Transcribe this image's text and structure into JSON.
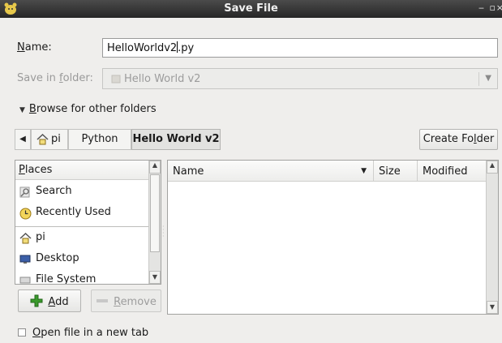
{
  "window": {
    "title": "Save File"
  },
  "form": {
    "name_label_u": "N",
    "name_label_rest": "ame:",
    "name_value": "HelloWorldv2",
    "name_value_tail": ".py",
    "folder_label_pre": "Save in ",
    "folder_label_u": "f",
    "folder_label_rest": "older:",
    "folder_value": "Hello World v2"
  },
  "browse": {
    "label_u": "B",
    "label_rest": "rowse for other folders"
  },
  "breadcrumb": {
    "items": [
      {
        "label": "pi",
        "icon": "home-icon"
      },
      {
        "label": "Python"
      },
      {
        "label": "Hello World v2",
        "active": true
      }
    ]
  },
  "toolbar": {
    "create_folder_pre": "Create Fo",
    "create_folder_u": "l",
    "create_folder_rest": "der"
  },
  "places": {
    "header_u": "P",
    "header_rest": "laces",
    "items": [
      {
        "label": "Search",
        "icon": "search-icon"
      },
      {
        "label": "Recently Used",
        "icon": "clock-icon"
      },
      {
        "label": "pi",
        "icon": "home-icon"
      },
      {
        "label": "Desktop",
        "icon": "desktop-icon"
      },
      {
        "label": "File System",
        "icon": "drive-icon"
      }
    ],
    "add_u": "A",
    "add_rest": "dd",
    "remove_u": "R",
    "remove_rest": "emove"
  },
  "files": {
    "columns": [
      {
        "label": "Name"
      },
      {
        "label": "Size"
      },
      {
        "label": "Modified"
      }
    ]
  },
  "options": {
    "new_tab_u": "O",
    "new_tab_rest": "pen file in a new tab",
    "new_tab_checked": false
  },
  "colors": {
    "titlebar": "#2f2f2f",
    "accent_green": "#3a9a2c"
  }
}
